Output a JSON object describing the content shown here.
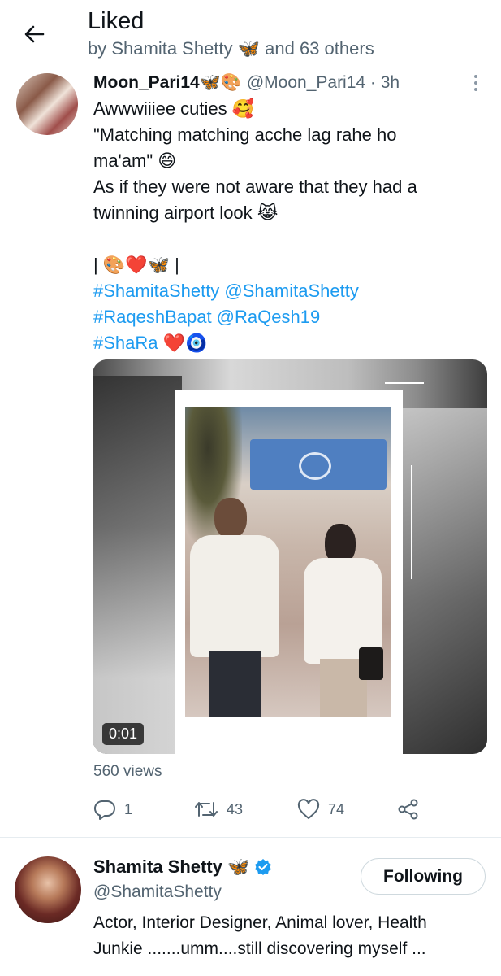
{
  "header": {
    "title": "Liked",
    "subtitle": "by Shamita Shetty 🦋 and 63 others"
  },
  "tweet": {
    "author_name": "Moon_Pari14🦋🎨",
    "handle_time": " @Moon_Pari14 · 3h",
    "lines": [
      "Awwwiiiee cuties 🥰",
      "\"Matching matching acche lag rahe ho",
      "ma'am\" 😄",
      "As if they were not aware that they had a",
      "twinning airport look 😹",
      "",
      "| 🎨❤️🦋 |",
      "#ShamitaShetty @ShamitaShetty",
      "#RaqeshBapat @RaQesh19",
      "#ShaRa ❤️🧿"
    ],
    "video_duration": "0:01",
    "views": "560 views",
    "replies": "1",
    "retweets": "43",
    "likes": "74"
  },
  "profile": {
    "name": "Shamita Shetty 🦋",
    "handle": "@ShamitaShetty",
    "follow_label": "Following",
    "bio_line1": "Actor, Interior Designer, Animal lover, Health",
    "bio_line2": "Junkie .......umm....still discovering myself ..."
  },
  "colors": {
    "link": "#1d9bf0",
    "muted": "#536471",
    "verified": "#1d9bf0"
  },
  "icons": {
    "back": "arrow-left-icon",
    "more": "more-vertical-icon",
    "reply": "reply-icon",
    "retweet": "retweet-icon",
    "like": "heart-icon",
    "share": "share-icon",
    "verified": "verified-badge-icon"
  }
}
